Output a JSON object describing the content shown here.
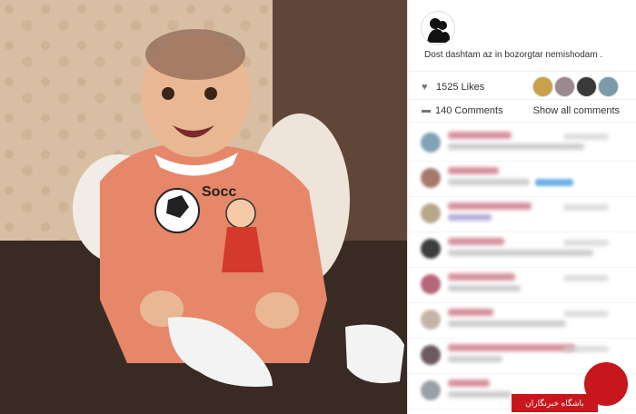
{
  "post": {
    "caption": "Dost dashtam az in bozorgtar nemishodam .",
    "likes_label": "1525 Likes",
    "comments_label": "140 Comments",
    "show_all_label": "Show all comments"
  },
  "icons": {
    "heart": "heart-icon",
    "comment": "comment-icon"
  },
  "watermark": {
    "text": "باشگاه خبرنگاران"
  },
  "colors": {
    "watermark_red": "#c8161d",
    "blurred_name": "#c96b7a",
    "blurred_link": "#6fb3e6"
  }
}
